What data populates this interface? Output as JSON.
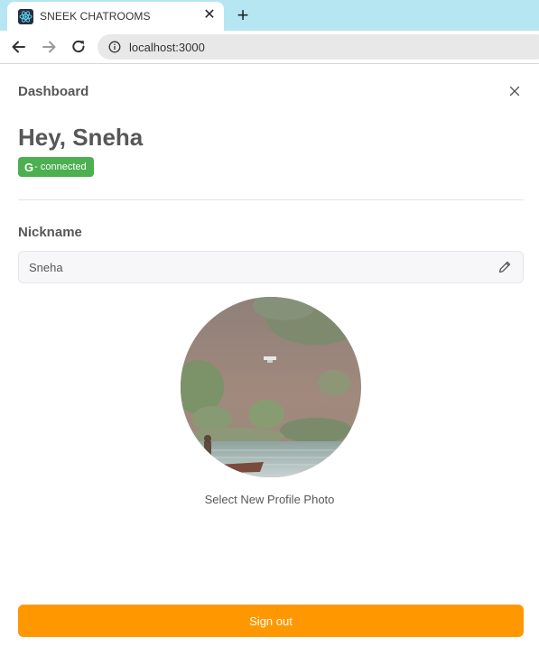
{
  "browser": {
    "tab_title": "SNEEK CHATROOMS",
    "tab_close": "✕",
    "new_tab": "+",
    "url": "localhost:3000",
    "icons": [
      "react-favicon-icon",
      "close-icon",
      "plus-icon",
      "back-arrow-icon",
      "forward-arrow-icon",
      "reload-icon",
      "info-icon"
    ]
  },
  "dashboard": {
    "title": "Dashboard",
    "greeting": "Hey, Sneha",
    "badge": {
      "icon": "G",
      "text": "connected",
      "color": "#4caf50"
    },
    "nickname_label": "Nickname",
    "nickname_value": "Sneha",
    "photo_label": "Select New Profile Photo",
    "signout_label": "Sign out",
    "signout_color": "#ff9800",
    "icons": [
      "close-icon",
      "pencil-icon",
      "google-icon"
    ]
  }
}
